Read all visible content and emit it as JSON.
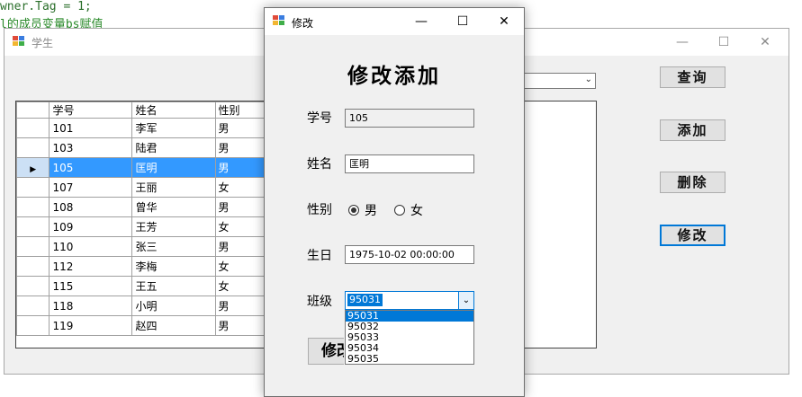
{
  "editor": {
    "line1": "wner.Tag = 1;",
    "line2": "l的成员变量bs赋值"
  },
  "main_window": {
    "title": "学生",
    "buttons": {
      "query": "查询",
      "add": "添加",
      "delete": "删除",
      "edit": "修改"
    },
    "grid": {
      "columns": [
        "学号",
        "姓名",
        "性别"
      ],
      "rows": [
        {
          "id": "101",
          "name": "李军",
          "gender": "男"
        },
        {
          "id": "103",
          "name": "陆君",
          "gender": "男"
        },
        {
          "id": "105",
          "name": "匡明",
          "gender": "男",
          "selected": true
        },
        {
          "id": "107",
          "name": "王丽",
          "gender": "女"
        },
        {
          "id": "108",
          "name": "曾华",
          "gender": "男"
        },
        {
          "id": "109",
          "name": "王芳",
          "gender": "女"
        },
        {
          "id": "110",
          "name": "张三",
          "gender": "男"
        },
        {
          "id": "112",
          "name": "李梅",
          "gender": "女"
        },
        {
          "id": "115",
          "name": "王五",
          "gender": "女"
        },
        {
          "id": "118",
          "name": "小明",
          "gender": "男"
        },
        {
          "id": "119",
          "name": "赵四",
          "gender": "男"
        }
      ]
    }
  },
  "dialog": {
    "title": "修改",
    "heading": "修改添加",
    "labels": {
      "id": "学号",
      "name": "姓名",
      "gender": "性别",
      "birthday": "生日",
      "class": "班级"
    },
    "values": {
      "id": "105",
      "name": "匡明",
      "birthday": "1975-10-02 00:00:00",
      "class": "95031"
    },
    "gender_options": {
      "male": "男",
      "female": "女",
      "selected": "male"
    },
    "class_options": [
      "95031",
      "95032",
      "95033",
      "95034",
      "95035"
    ],
    "submit_label": "修改"
  },
  "colors": {
    "selection": "#3399ff",
    "focus_accent": "#0078d7"
  }
}
